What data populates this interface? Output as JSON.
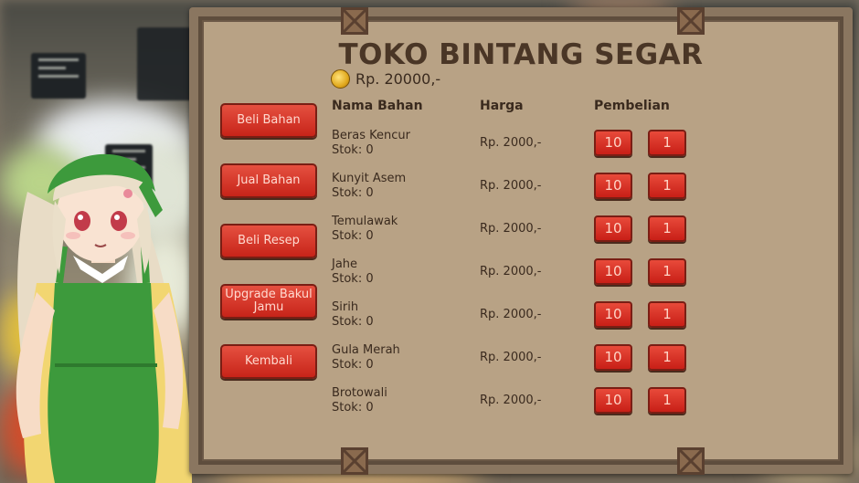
{
  "shop": {
    "title": "TOKO BINTANG SEGAR",
    "money": "Rp. 20000,-"
  },
  "menu": [
    {
      "label": "Beli Bahan"
    },
    {
      "label": "Jual Bahan"
    },
    {
      "label": "Beli Resep"
    },
    {
      "label": "Upgrade Bakul Jamu"
    },
    {
      "label": "Kembali"
    }
  ],
  "table": {
    "headers": {
      "name": "Nama Bahan",
      "price": "Harga",
      "buy": "Pembelian"
    },
    "items": [
      {
        "name": "Beras Kencur",
        "stock": "Stok: 0",
        "price": "Rp. 2000,-",
        "buy10": "10",
        "buy1": "1"
      },
      {
        "name": "Kunyit Asem",
        "stock": "Stok: 0",
        "price": "Rp. 2000,-",
        "buy10": "10",
        "buy1": "1"
      },
      {
        "name": "Temulawak",
        "stock": "Stok: 0",
        "price": "Rp. 2000,-",
        "buy10": "10",
        "buy1": "1"
      },
      {
        "name": "Jahe",
        "stock": "Stok: 0",
        "price": "Rp. 2000,-",
        "buy10": "10",
        "buy1": "1"
      },
      {
        "name": "Sirih",
        "stock": "Stok: 0",
        "price": "Rp. 2000,-",
        "buy10": "10",
        "buy1": "1"
      },
      {
        "name": "Gula Merah",
        "stock": "Stok: 0",
        "price": "Rp. 2000,-",
        "buy10": "10",
        "buy1": "1"
      },
      {
        "name": "Brotowali",
        "stock": "Stok: 0",
        "price": "Rp. 2000,-",
        "buy10": "10",
        "buy1": "1"
      }
    ]
  },
  "colors": {
    "panel": "#b8a285",
    "panel_border": "#8a7660",
    "button_red": "#d8352a",
    "title_text": "#4a3626"
  },
  "icons": {
    "coin": "coin-icon",
    "character": "shopkeeper-character"
  }
}
